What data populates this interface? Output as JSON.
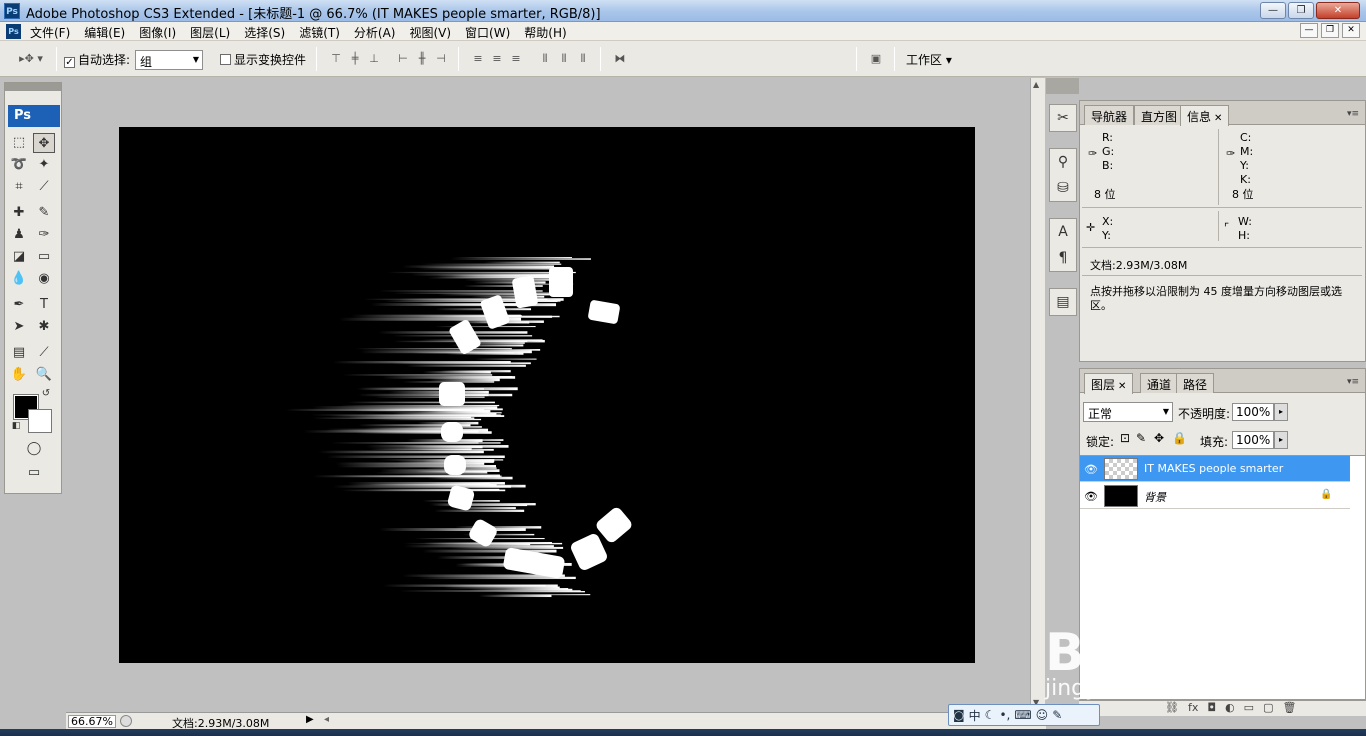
{
  "window": {
    "title": "Adobe Photoshop CS3 Extended - [未标题-1 @ 66.7% (IT  MAKES people smarter, RGB/8)]",
    "app_icon": "Ps",
    "buttons": [
      "minimize",
      "restore",
      "close"
    ]
  },
  "menu": {
    "items": [
      "文件(F)",
      "编辑(E)",
      "图像(I)",
      "图层(L)",
      "选择(S)",
      "滤镜(T)",
      "分析(A)",
      "视图(V)",
      "窗口(W)",
      "帮助(H)"
    ]
  },
  "options": {
    "auto_select_label": "自动选择:",
    "auto_select_checked": true,
    "auto_select_value": "组",
    "show_transform_label": "显示变换控件",
    "show_transform_checked": false,
    "workspace_label": "工作区"
  },
  "toolbox": {
    "logo": "Ps",
    "foreground_color": "#000000",
    "background_color": "#ffffff"
  },
  "canvas": {
    "background": "#000000",
    "text_layer": "IT MAKES people smarter"
  },
  "statusbar": {
    "zoom": "66.67%",
    "doc_size": "文档:2.93M/3.08M"
  },
  "info_panel": {
    "tabs": [
      "导航器",
      "直方图",
      "信息"
    ],
    "active_tab": "信息",
    "rgb_labels": [
      "R:",
      "G:",
      "B:"
    ],
    "cmyk_labels": [
      "C:",
      "M:",
      "Y:",
      "K:"
    ],
    "bit_depth_left": "8 位",
    "bit_depth_right": "8 位",
    "xy_labels": [
      "X:",
      "Y:"
    ],
    "wh_labels": [
      "W:",
      "H:"
    ],
    "doc_size": "文档:2.93M/3.08M",
    "hint": "点按并拖移以沿限制为 45 度增量方向移动图层或选区。"
  },
  "layers_panel": {
    "tabs": [
      "图层",
      "通道",
      "路径"
    ],
    "active_tab": "图层",
    "blend_mode": "正常",
    "opacity_label": "不透明度:",
    "opacity_value": "100%",
    "lock_label": "锁定:",
    "fill_label": "填充:",
    "fill_value": "100%",
    "layers": [
      {
        "name": "IT  MAKES people smarter",
        "visible": true,
        "selected": true
      },
      {
        "name": "背景",
        "visible": true,
        "selected": false,
        "locked": true
      }
    ]
  },
  "ime": {
    "mode": "中"
  },
  "watermark": {
    "brand": "Bai du 经验",
    "url": "jingyan.baidu.com"
  }
}
